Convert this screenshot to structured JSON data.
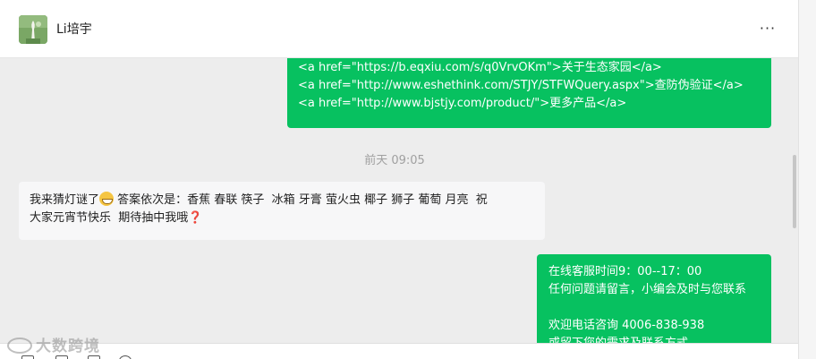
{
  "header": {
    "contact_name": "Li培宇",
    "more_label": "···"
  },
  "messages": {
    "msg1": {
      "lines": [
        "<a href=\"https://b.eqxiu.com/s/q0VrvOKm\">关于生态家园</a>",
        "<a href=\"http://www.eshethink.com/STJY/STFWQuery.aspx\">查防伪验证</a>",
        "<a href=\"http://www.bjstjy.com/product/\">更多产品</a>"
      ]
    },
    "time_separator": "前天 09:05",
    "msg2": {
      "line1_a": "我来猜灯谜了",
      "line1_b": " 答案依次是：香蕉 春联 筷子  冰箱 牙膏 萤火虫 椰子 狮子 葡萄 月亮  祝",
      "line2_a": "大家元宵节快乐  期待抽中我哦",
      "question_mark": "❓"
    },
    "msg3": {
      "lines": [
        "在线客服时间9：00--17：00",
        "任何问题请留言，小编会及时与您联系",
        "",
        "欢迎电话咨询 4006-838-938",
        "或留下您的需求及联系方式"
      ]
    }
  },
  "watermark": {
    "text": "大数跨境"
  },
  "colors": {
    "outgoing_bubble": "#07c160",
    "incoming_bubble": "#f7f7f8",
    "background": "#ededed"
  }
}
